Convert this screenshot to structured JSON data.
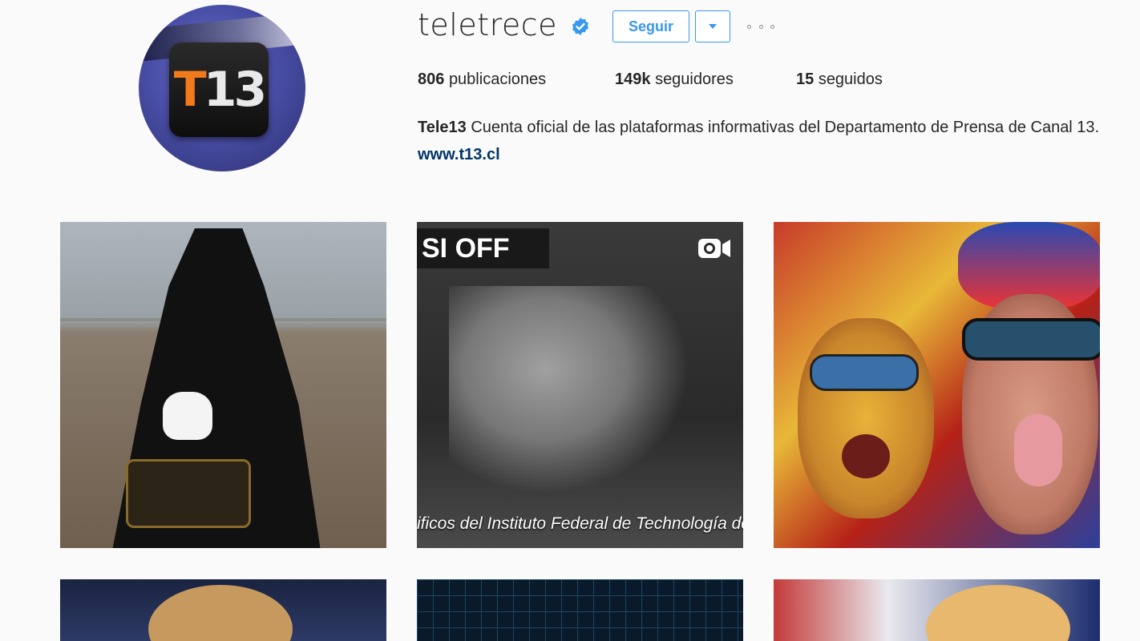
{
  "profile": {
    "username": "teletrece",
    "verified": true,
    "follow_label": "Seguir",
    "dropdown_icon": "chevron-down-icon",
    "more_icon": "more-options-icon",
    "avatar": {
      "logo_t": "T",
      "logo_13": "13"
    }
  },
  "stats": {
    "posts_count": "806",
    "posts_label": "publicaciones",
    "followers_count": "149k",
    "followers_label": "seguidores",
    "following_count": "15",
    "following_label": "seguidos"
  },
  "bio": {
    "name": "Tele13",
    "text": "Cuenta oficial de las plataformas informativas del Departamento de Prensa de Canal 13.",
    "link": "www.t13.cl"
  },
  "posts": [
    {
      "type": "photo"
    },
    {
      "type": "video",
      "overlay_title": "SI OFF",
      "caption": "ificos del Instituto Federal de Technología de S"
    },
    {
      "type": "photo"
    },
    {
      "type": "photo"
    },
    {
      "type": "photo"
    },
    {
      "type": "photo"
    }
  ],
  "colors": {
    "accent": "#3897f0",
    "link": "#003569",
    "background": "#fafafa"
  }
}
